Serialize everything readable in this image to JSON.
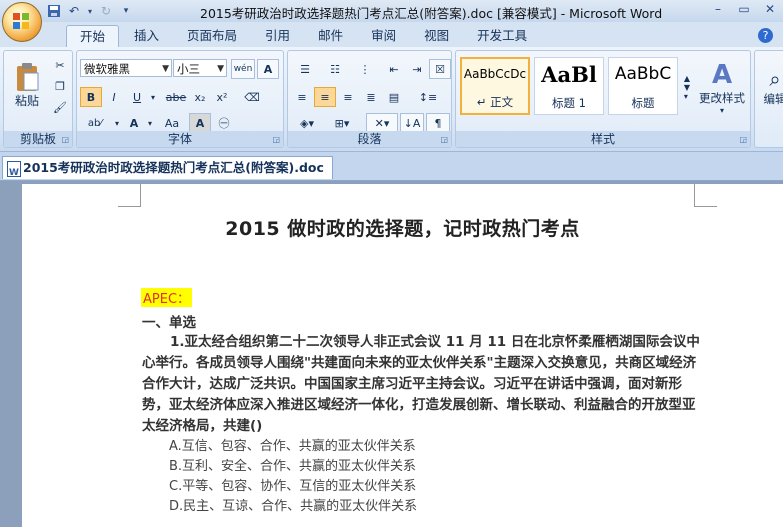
{
  "window": {
    "title": "2015考研政治时政选择题热门考点汇总(附答案).doc [兼容模式] - Microsoft Word",
    "controls": [
      "–",
      "▭",
      "✕"
    ]
  },
  "quick_access": [
    "save-icon",
    "undo-icon",
    "redo-icon",
    "customize-icon"
  ],
  "tabs": [
    "开始",
    "插入",
    "页面布局",
    "引用",
    "邮件",
    "审阅",
    "视图",
    "开发工具"
  ],
  "active_tab": "开始",
  "ribbon": {
    "clipboard": {
      "paste_label": "粘贴",
      "group_label": "剪贴板"
    },
    "font": {
      "font_name": "微软雅黑",
      "font_size": "小三",
      "buttons": [
        "B",
        "I",
        "U",
        "abe",
        "x₂",
        "x²",
        "Aa"
      ],
      "font_color": "#e0302a",
      "highlight_color": "#ffff00",
      "group_label": "字体"
    },
    "paragraph": {
      "group_label": "段落"
    },
    "styles": {
      "tiles": [
        {
          "sample": "AaBbCcDc",
          "name": "↵ 正文",
          "selected": true
        },
        {
          "sample": "AaBl",
          "name": "标题 1",
          "selected": false
        },
        {
          "sample": "AaBbC",
          "name": "标题",
          "selected": false
        }
      ],
      "change_styles": "更改样式",
      "group_label": "样式"
    },
    "editing": {
      "label": "编辑"
    }
  },
  "document_tab": "2015考研政治时政选择题热门考点汇总(附答案).doc",
  "document": {
    "heading": "2015 做时政的选择题，记时政热门考点",
    "section_label": "APEC：",
    "question_type": "一、单选",
    "question": "1.亚太经合组织第二十二次领导人非正式会议 11 月 11 日在北京怀柔雁栖湖国际会议中心举行。各成员领导人围绕\"共建面向未来的亚太伙伴关系\"主题深入交换意见，共商区域经济合作大计，达成广泛共识。中国国家主席习近平主持会议。习近平在讲话中强调，面对新形势，亚太经济体应深入推进区域经济一体化，打造发展创新、增长联动、利益融合的开放型亚太经济格局，共建()",
    "options": [
      "A.互信、包容、合作、共赢的亚太伙伴关系",
      "B.互利、安全、合作、共赢的亚太伙伴关系",
      "C.平等、包容、协作、互信的亚太伙伴关系",
      "D.民主、互谅、合作、共赢的亚太伙伴关系"
    ]
  }
}
